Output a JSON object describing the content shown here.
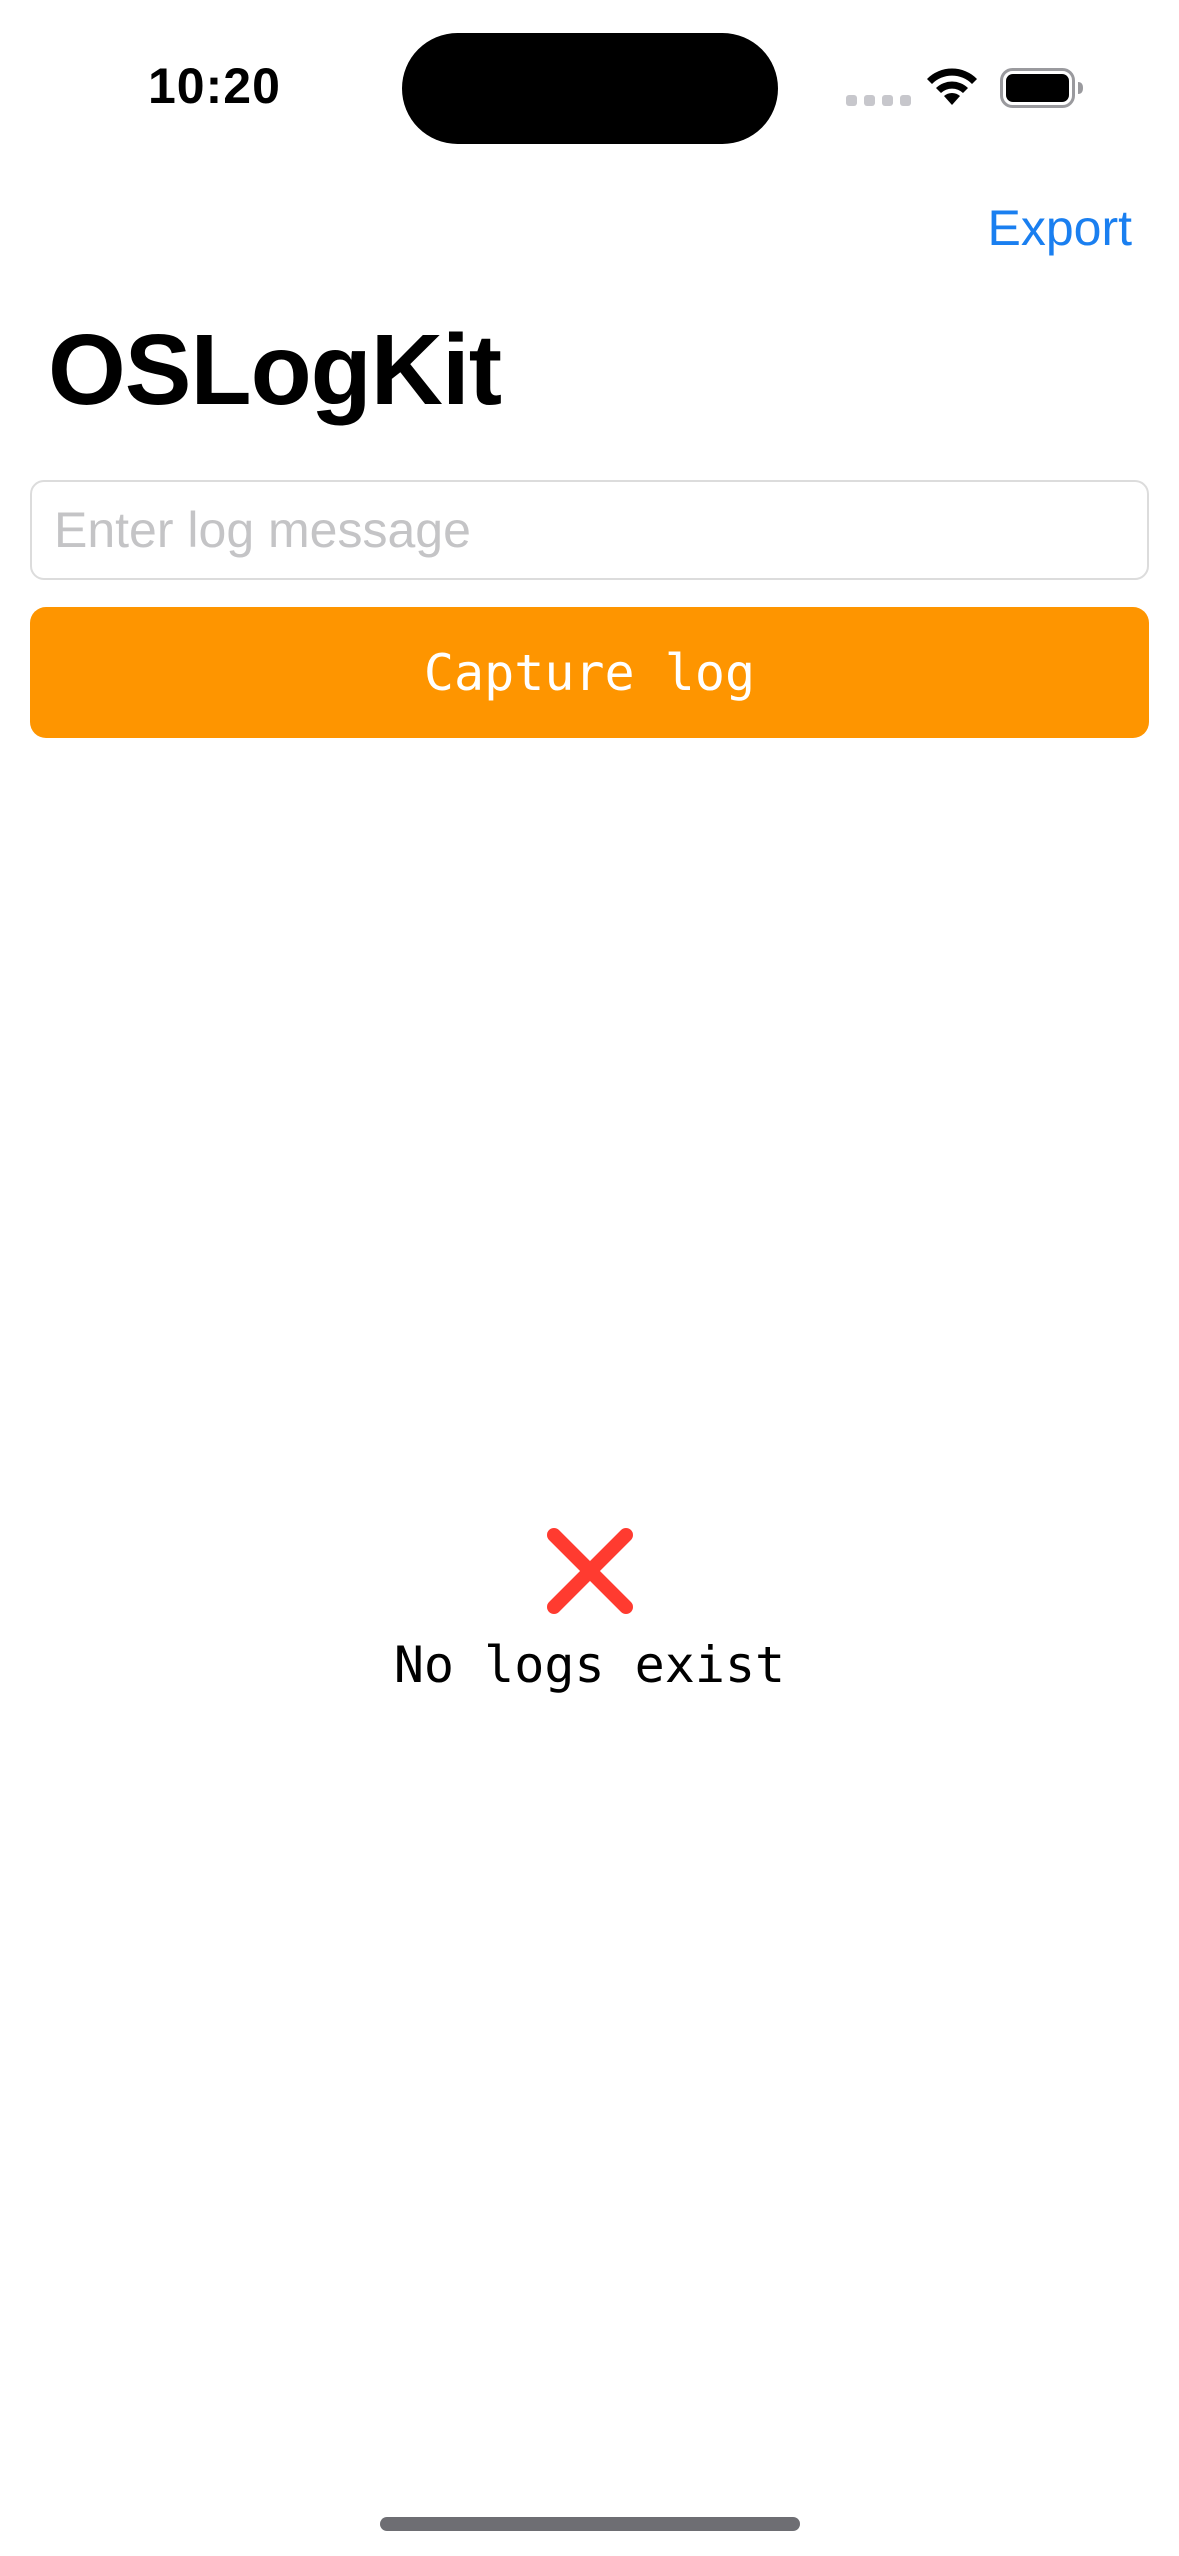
{
  "status_bar": {
    "time": "10:20",
    "icons": [
      "cellular-signal-icon",
      "wifi-icon",
      "battery-icon"
    ]
  },
  "nav": {
    "export_label": "Export"
  },
  "header": {
    "title": "OSLogKit"
  },
  "form": {
    "input_value": "",
    "input_placeholder": "Enter log message",
    "capture_label": "Capture log"
  },
  "empty_state": {
    "icon": "x-mark-icon",
    "message": "No logs exist"
  },
  "colors": {
    "accent_blue": "#1a7ff0",
    "button_orange": "#fe9500",
    "error_red": "#ff3b30"
  }
}
